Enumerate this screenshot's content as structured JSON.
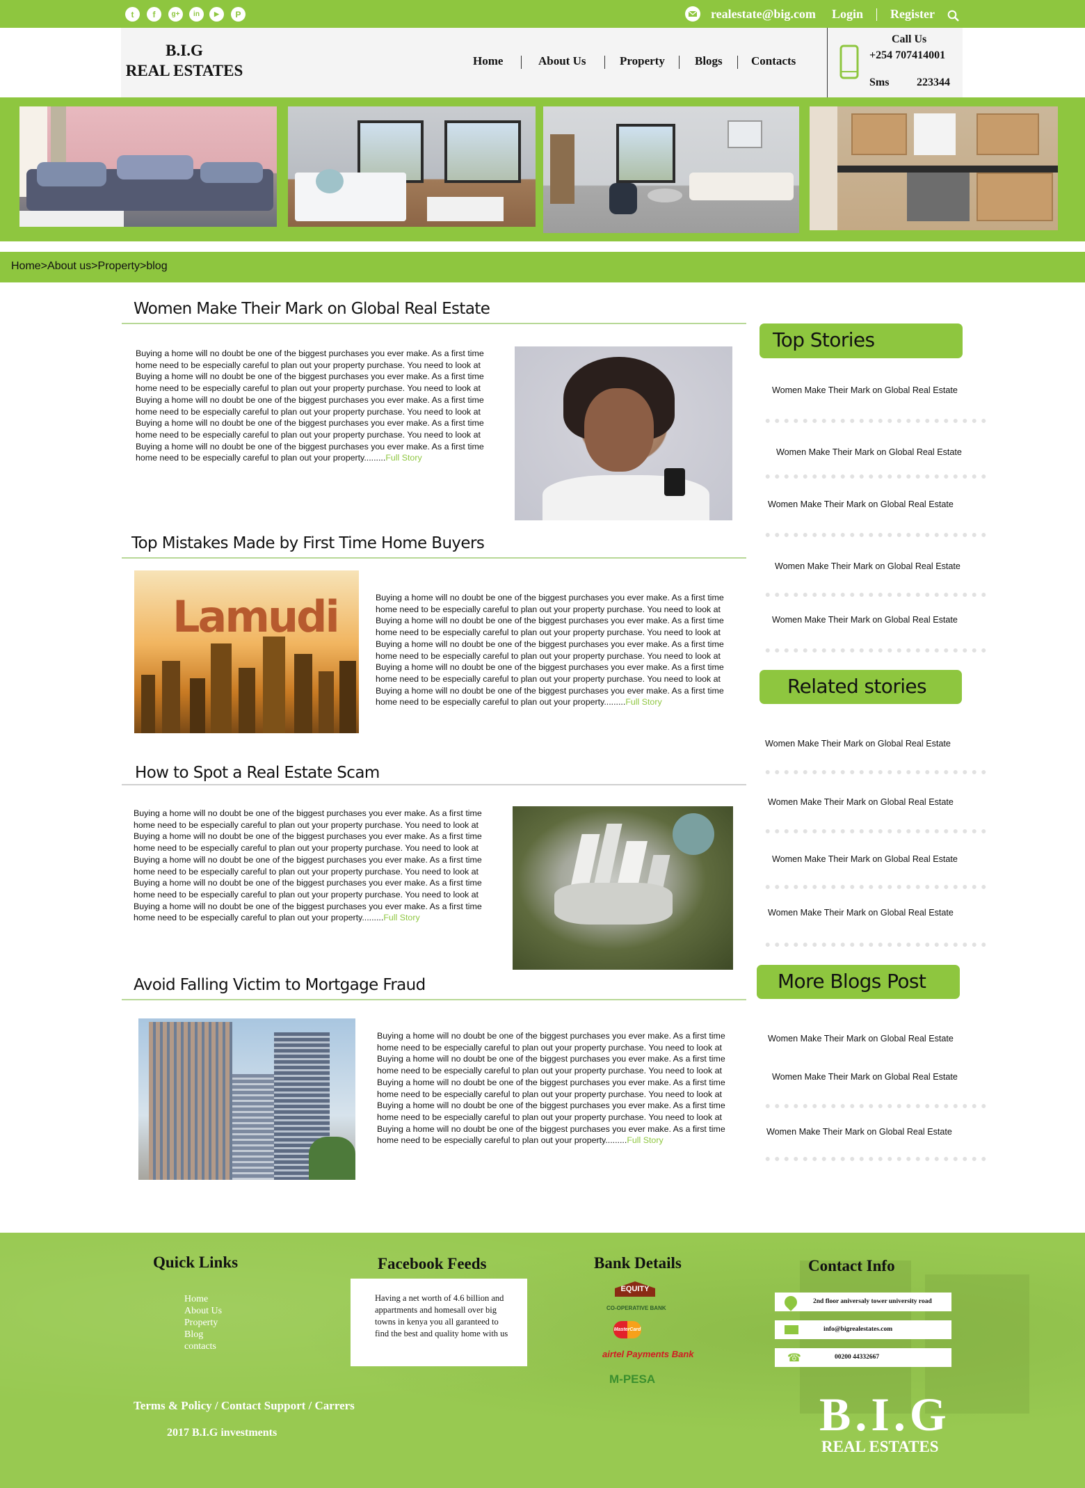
{
  "topbar": {
    "social": [
      {
        "icon": "twitter-icon",
        "glyph": "t"
      },
      {
        "icon": "facebook-icon",
        "glyph": "f"
      },
      {
        "icon": "google-plus-icon",
        "glyph": "g+"
      },
      {
        "icon": "linkedin-icon",
        "glyph": "in"
      },
      {
        "icon": "youtube-icon",
        "glyph": "▶"
      },
      {
        "icon": "pinterest-icon",
        "glyph": "P"
      }
    ],
    "email": "realestate@big.com",
    "login": "Login",
    "register": "Register",
    "email_icon": "mail-icon",
    "search_icon": "search-icon"
  },
  "header": {
    "logo_line1": "B.I.G",
    "logo_line2": "REAL ESTATES",
    "nav": [
      "Home",
      "About Us",
      "Property",
      "Blogs",
      "Contacts"
    ],
    "call_label": "Call Us",
    "phone": "+254 707414001",
    "sms_label": "Sms",
    "sms_number": "223344",
    "phone_icon": "mobile-phone-icon"
  },
  "breadcrumb": "Home>About us>Property>blog",
  "posts": [
    {
      "title": "Women Make Their Mark on Global Real Estate",
      "body": "Buying a home will no doubt be one of the biggest purchases you ever make. As a first time home need to be especially careful to plan out your property purchase. You need to look at Buying a home will no doubt be one of the biggest purchases you ever make. As a first time home need to be especially careful to plan out your property purchase. You need to look at Buying a home will no doubt be one of the biggest purchases you ever make. As a first time home need to be especially careful to plan out your property purchase. You need to look at Buying a home will no doubt be one of the biggest purchases you ever make. As a first time home need to be especially careful to plan out your property purchase. You need to look at Buying a home will no doubt be one of the biggest purchases you ever make. As a first time home need to be especially careful to plan out your property.........",
      "more": "Full Story"
    },
    {
      "title": "Top Mistakes Made by First Time Home Buyers",
      "body": "Buying a home will no doubt be one of the biggest purchases you ever make. As a first time home need to be especially careful to plan out your property purchase. You need to look at Buying a home will no doubt be one of the biggest purchases you ever make. As a first time home need to be especially careful to plan out your property purchase. You need to look at Buying a home will no doubt be one of the biggest purchases you ever make. As a first time home need to be especially careful to plan out your property purchase. You need to look at Buying a home will no doubt be one of the biggest purchases you ever make. As a first time home need to be especially careful to plan out your property purchase. You need to look at Buying a home will no doubt be one of the biggest purchases you ever make. As a first time home need to be especially careful to plan out your property.........",
      "more": "Full Story",
      "image_text": "Lamudi"
    },
    {
      "title": "How to Spot a Real Estate Scam",
      "body": "Buying a home will no doubt be one of the biggest purchases you ever make. As a first time home need to be especially careful to plan out your property purchase. You need to look at Buying a home will no doubt be one of the biggest purchases you ever make. As a first time home need to be especially careful to plan out your property purchase. You need to look at Buying a home will no doubt be one of the biggest purchases you ever make. As a first time home need to be especially careful to plan out your property purchase. You need to look at Buying a home will no doubt be one of the biggest purchases you ever make. As a first time home need to be especially careful to plan out your property purchase. You need to look at Buying a home will no doubt be one of the biggest purchases you ever make. As a first time home need to be especially careful to plan out your property.........",
      "more": "Full Story"
    },
    {
      "title": "Avoid Falling Victim to Mortgage Fraud",
      "body": "Buying a home will no doubt be one of the biggest purchases you ever make. As a first time home need to be especially careful to plan out your property purchase. You need to look at Buying a home will no doubt be one of the biggest purchases you ever make. As a first time home need to be especially careful to plan out your property purchase. You need to look at Buying a home will no doubt be one of the biggest purchases you ever make. As a first time home need to be especially careful to plan out your property purchase. You need to look at Buying a home will no doubt be one of the biggest purchases you ever make. As a first time home need to be especially careful to plan out your property purchase. You need to look at Buying a home will no doubt be one of the biggest purchases you ever make. As a first time home need to be especially careful to plan out your property.........",
      "more": "Full Story"
    }
  ],
  "sidebar": {
    "top_stories": {
      "heading": "Top Stories",
      "items": [
        "Women Make Their Mark on Global Real Estate",
        "Women Make Their Mark on Global Real Estate",
        "Women Make Their Mark on Global Real Estate",
        "Women Make Their Mark on Global Real Estate",
        "Women Make Their Mark on Global Real Estate"
      ]
    },
    "related": {
      "heading": "Related stories",
      "items": [
        "Women Make Their Mark on Global Real Estate",
        "Women Make Their Mark on Global Real Estate",
        "Women Make Their Mark on Global Real Estate",
        "Women Make Their Mark on Global Real Estate"
      ]
    },
    "more_blogs": {
      "heading": "More Blogs Post",
      "items": [
        "Women Make Their Mark on Global Real Estate",
        "Women Make Their Mark on Global Real Estate",
        "Women Make Their Mark on Global Real Estate"
      ]
    }
  },
  "footer": {
    "quick_links_title": "Quick Links",
    "quick_links": [
      "Home",
      "About Us",
      "Property",
      "Blog",
      "contacts"
    ],
    "facebook_title": "Facebook Feeds",
    "facebook_text": "Having a net worth of 4.6 billion and appartments and homesall over big towns in kenya you all garanteed to find the best and quality home with us",
    "bank_title": "Bank Details",
    "banks": [
      "EQUITY",
      "CO-OPERATIVE BANK",
      "MasterCard",
      "airtel Payments Bank",
      "M-PESA"
    ],
    "contact_title": "Contact Info",
    "address": "2nd floor aniversaly tower university road",
    "email": "info@bigrealestates.com",
    "phone": "00200 44332667",
    "contact_icons": [
      "location-icon",
      "mail-icon",
      "phone-icon"
    ],
    "legal_links": "Terms & Policy / Contact Support / Carrers",
    "copyright": "2017 B.I.G investments",
    "logo_big": "B.I.G",
    "logo_small": "REAL ESTATES"
  },
  "colors": {
    "brand_green": "#8ec63f",
    "header_bg": "#f4f4f4",
    "footer_green": "#98c951"
  }
}
